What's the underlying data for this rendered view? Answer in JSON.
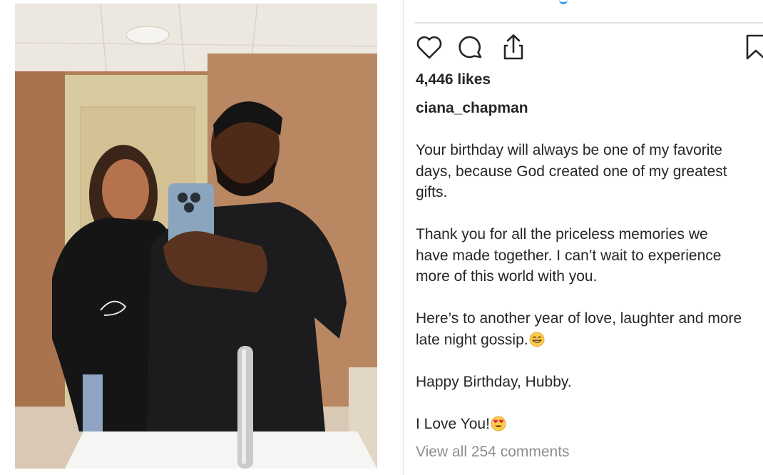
{
  "post": {
    "likes": "4,446 likes",
    "username": "ciana_chapman",
    "caption": {
      "p1_l1": "Your birthday will always be one of my favorite",
      "p1_l2": "days, because God created one of my greatest",
      "p1_l3": "gifts.",
      "p2_l1": "Thank you for all the priceless memories we",
      "p2_l2": "have made together. I can’t wait to experience",
      "p2_l3": "more of this world with you.",
      "p3_l1": "Here’s to another year of love, laughter and more",
      "p3_l2": "late night gossip.",
      "p4": "Happy Birthday, Hubby.",
      "p5": "I Love You!"
    },
    "view_comments": "View all 254 comments"
  },
  "icons": {
    "like": "heart-icon",
    "comment": "comment-bubble-icon",
    "share": "share-icon",
    "save": "bookmark-icon",
    "grin": "grinning-face-emoji",
    "heart_eyes": "heart-eyes-emoji"
  },
  "colors": {
    "text": "#262626",
    "muted": "#8e8e8e",
    "accent": "#2f9cf0"
  }
}
